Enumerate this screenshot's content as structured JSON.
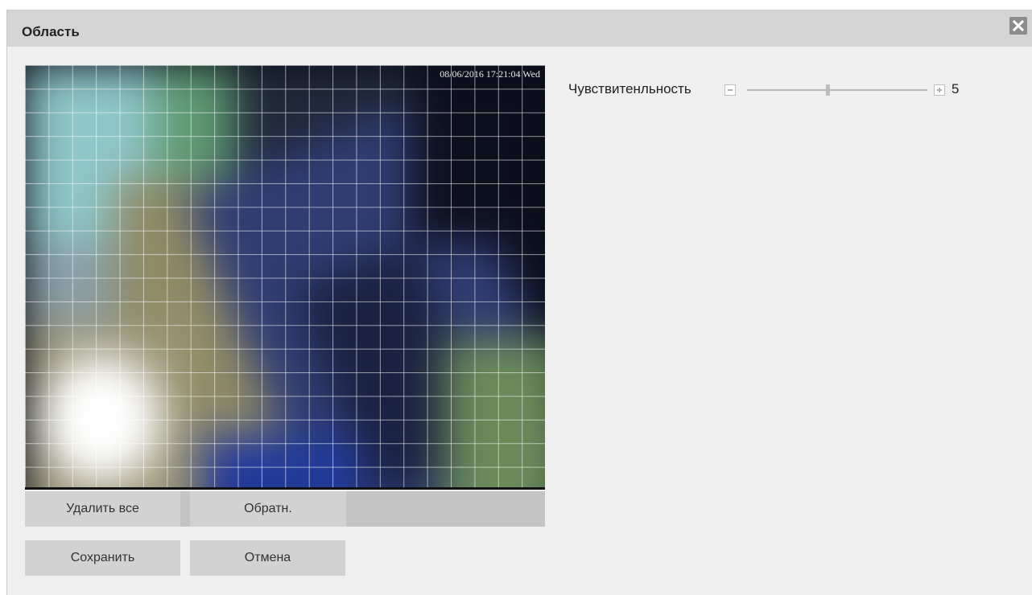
{
  "dialog": {
    "title": "Область",
    "close_icon": "close-icon"
  },
  "video": {
    "osd_timestamp": "08/06/2016 17:21:04 Wed"
  },
  "region_buttons": {
    "delete_all_label": "Удалить все",
    "invert_label": "Обратн."
  },
  "actions": {
    "save_label": "Сохранить",
    "cancel_label": "Отмена"
  },
  "sensitivity": {
    "label": "Чувствитенльность",
    "value": "5",
    "min": 1,
    "max": 10,
    "level": 5,
    "minus_icon": "minus-icon",
    "plus_icon": "plus-icon"
  }
}
